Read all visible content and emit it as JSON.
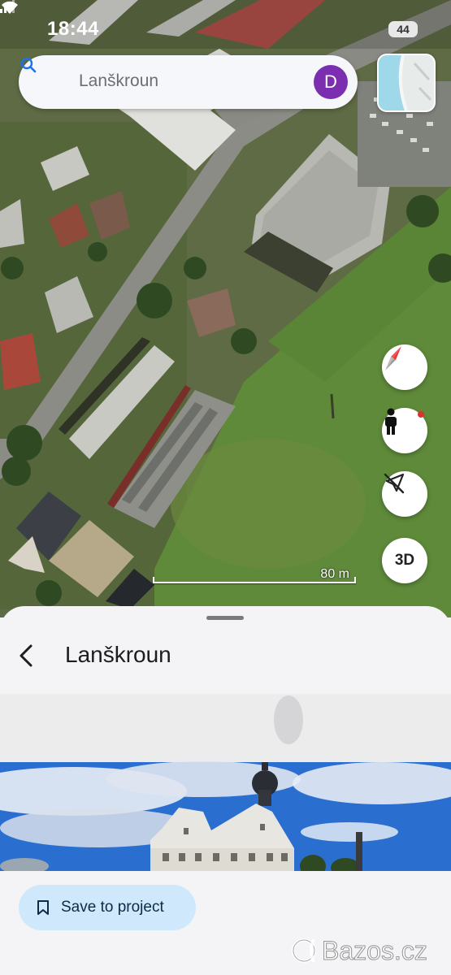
{
  "status_bar": {
    "time": "18:44",
    "battery": "44"
  },
  "search": {
    "placeholder": "Lanškroun",
    "avatar_letter": "D"
  },
  "map": {
    "scale_label": "80 m"
  },
  "controls": {
    "three_d_label": "3D"
  },
  "sheet": {
    "title": "Lanškroun"
  },
  "actions": {
    "save_label": "Save to project"
  },
  "icons": [
    "search-icon",
    "compass-icon",
    "street-view-icon",
    "location-off-icon",
    "back-arrow-icon",
    "bookmark-icon"
  ],
  "watermark": {
    "text": "Bazos.cz"
  },
  "colors": {
    "avatar": "#7b2fb0",
    "save_button": "#cfe8fb",
    "accent": "#1a73e8"
  }
}
